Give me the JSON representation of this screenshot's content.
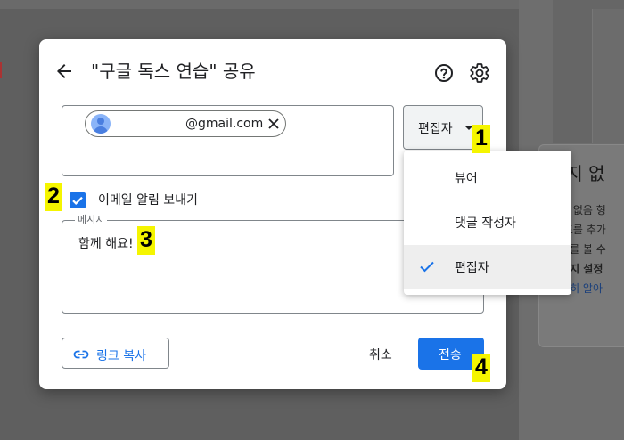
{
  "background": {
    "side_heading": "이지 없",
    "side_lines": [
      "이지 없음 형",
      "와 표를 추가",
      "문서를 볼 수",
      "페이지 설정",
      "자세히 알아"
    ]
  },
  "dialog": {
    "title": "\"구글 독스 연습\" 공유",
    "recipient_email": "@gmail.com",
    "role_button_label": "편집자",
    "notify_label": "이메일 알림 보내기",
    "notify_checked": true,
    "message_legend": "메시지",
    "message_text": "함께 해요!",
    "copy_link_label": "링크 복사",
    "cancel_label": "취소",
    "send_label": "전송"
  },
  "role_menu": {
    "items": [
      {
        "label": "뷰어",
        "selected": false
      },
      {
        "label": "댓글 작성자",
        "selected": false
      },
      {
        "label": "편집자",
        "selected": true
      }
    ]
  },
  "markers": [
    "1",
    "2",
    "3",
    "4"
  ],
  "colors": {
    "accent": "#1a73e8",
    "marker": "#f5f500",
    "overlay": "#5f5f5f"
  },
  "icons": [
    "back-arrow-icon",
    "help-icon",
    "gear-icon",
    "avatar-icon",
    "close-icon",
    "caret-down-icon",
    "checkbox-icon",
    "link-icon",
    "check-icon"
  ]
}
